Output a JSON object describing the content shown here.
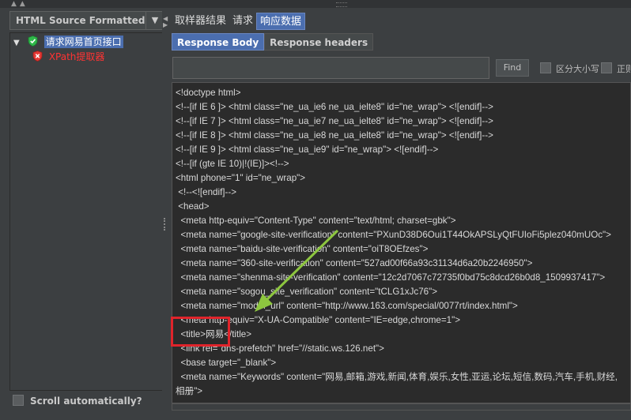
{
  "left_panel": {
    "renderer_select": "HTML Source Formatted",
    "tree": [
      {
        "label": "请求网易首页接口",
        "status": "success",
        "selected": true
      },
      {
        "label": "XPath提取器",
        "status": "error",
        "selected": false
      }
    ],
    "scroll_auto_label": "Scroll automatically?"
  },
  "right_panel": {
    "tabs": [
      "取样器结果",
      "请求",
      "响应数据"
    ],
    "active_tab": "响应数据",
    "sub_tabs": [
      "Response Body",
      "Response headers"
    ],
    "active_sub_tab": "Response Body",
    "search": {
      "value": "",
      "find_label": "Find",
      "case_label": "区分大小写",
      "regex_label": "正则"
    },
    "code_lines": [
      "<!doctype html>",
      "<!--[if IE 6 ]> <html class=\"ne_ua_ie6 ne_ua_ielte8\" id=\"ne_wrap\"> <![endif]-->",
      "<!--[if IE 7 ]> <html class=\"ne_ua_ie7 ne_ua_ielte8\" id=\"ne_wrap\"> <![endif]-->",
      "<!--[if IE 8 ]> <html class=\"ne_ua_ie8 ne_ua_ielte8\" id=\"ne_wrap\"> <![endif]-->",
      "<!--[if IE 9 ]> <html class=\"ne_ua_ie9\" id=\"ne_wrap\"> <![endif]-->",
      "<!--[if (gte IE 10)|!(IE)]><!-->",
      "<html phone=\"1\" id=\"ne_wrap\">",
      " <!--<![endif]-->",
      " <head>",
      "  <meta http-equiv=\"Content-Type\" content=\"text/html; charset=gbk\">",
      "  <meta name=\"google-site-verification\" content=\"PXunD38D6Oui1T44OkAPSLyQtFUIoFi5plez040mUOc\">",
      "  <meta name=\"baidu-site-verification\" content=\"oiT8OEfzes\">",
      "  <meta name=\"360-site-verification\" content=\"527ad00f66a93c31134d6a20b2246950\">",
      "  <meta name=\"shenma-site-verification\" content=\"12c2d7067c72735f0bd75c8dcd26b0d8_1509937417\">",
      "  <meta name=\"sogou_site_verification\" content=\"tCLG1xJc76\">",
      "  <meta name=\"model_url\" content=\"http://www.163.com/special/0077rt/index.html\">",
      "  <meta http-equiv=\"X-UA-Compatible\" content=\"IE=edge,chrome=1\">",
      "  <title>网易</title>",
      "  <link rel=\"dns-prefetch\" href=\"//static.ws.126.net\">",
      "  <base target=\"_blank\">",
      "  <meta name=\"Keywords\" content=\"网易,邮箱,游戏,新闻,体育,娱乐,女性,亚运,论坛,短信,数码,汽车,手机,财经,",
      "相册\">"
    ]
  },
  "colors": {
    "accent": "#4b6eaf",
    "annotation_red": "#e0242b",
    "annotation_arrow": "#8dc63f"
  }
}
